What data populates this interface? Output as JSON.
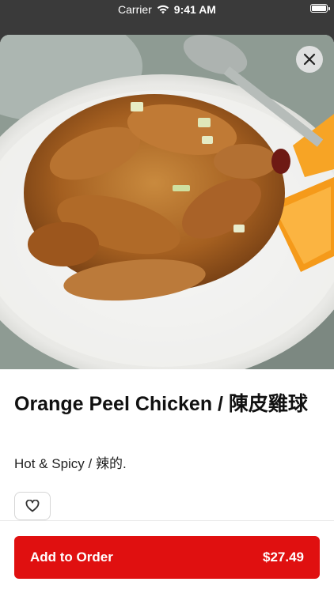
{
  "status_bar": {
    "carrier": "Carrier",
    "time": "9:41 AM"
  },
  "item": {
    "name": "Orange Peel Chicken / 陳皮雞球",
    "description": "Hot & Spicy / 辣的."
  },
  "order_button": {
    "label": "Add to Order",
    "price": "$27.49"
  },
  "colors": {
    "accent": "#e01010"
  },
  "icons": {
    "close": "close-icon",
    "favorite": "heart-icon",
    "wifi": "wifi-icon",
    "battery": "battery-icon"
  }
}
